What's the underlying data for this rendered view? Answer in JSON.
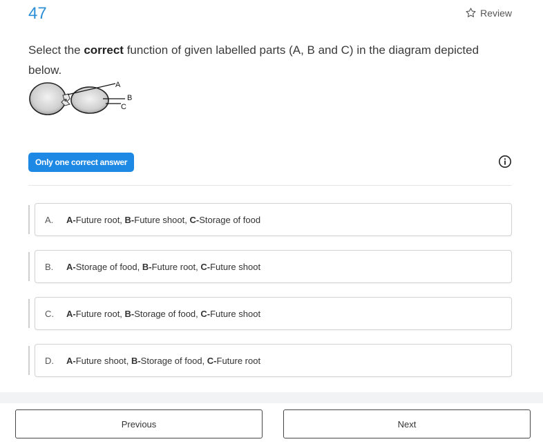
{
  "question": {
    "number": "47",
    "review_label": "Review",
    "text_before": "Select the ",
    "text_bold": "correct",
    "text_after": " function of given labelled parts (A, B and C) in the diagram depicted below.",
    "diagram_labels": {
      "a": "A",
      "b": "B",
      "c": "C"
    }
  },
  "badge": {
    "label": "Only one correct answer"
  },
  "options": [
    {
      "letter": "A.",
      "parts": [
        {
          "b": "A-",
          "t": "Future root, "
        },
        {
          "b": "B-",
          "t": "Future shoot, "
        },
        {
          "b": "C-",
          "t": "Storage of food"
        }
      ]
    },
    {
      "letter": "B.",
      "parts": [
        {
          "b": "A-",
          "t": "Storage of food, "
        },
        {
          "b": "B-",
          "t": "Future root, "
        },
        {
          "b": "C-",
          "t": "Future shoot"
        }
      ]
    },
    {
      "letter": "C.",
      "parts": [
        {
          "b": "A-",
          "t": "Future root, "
        },
        {
          "b": "B-",
          "t": "Storage of food, "
        },
        {
          "b": "C-",
          "t": "Future shoot"
        }
      ]
    },
    {
      "letter": "D.",
      "parts": [
        {
          "b": "A-",
          "t": "Future shoot, "
        },
        {
          "b": "B-",
          "t": "Storage of food, "
        },
        {
          "b": "C-",
          "t": "Future root"
        }
      ]
    }
  ],
  "nav": {
    "previous_label": "Previous",
    "next_label": "Next"
  },
  "colors": {
    "accent": "#1e88e5",
    "question_number": "#2c8fd6"
  }
}
